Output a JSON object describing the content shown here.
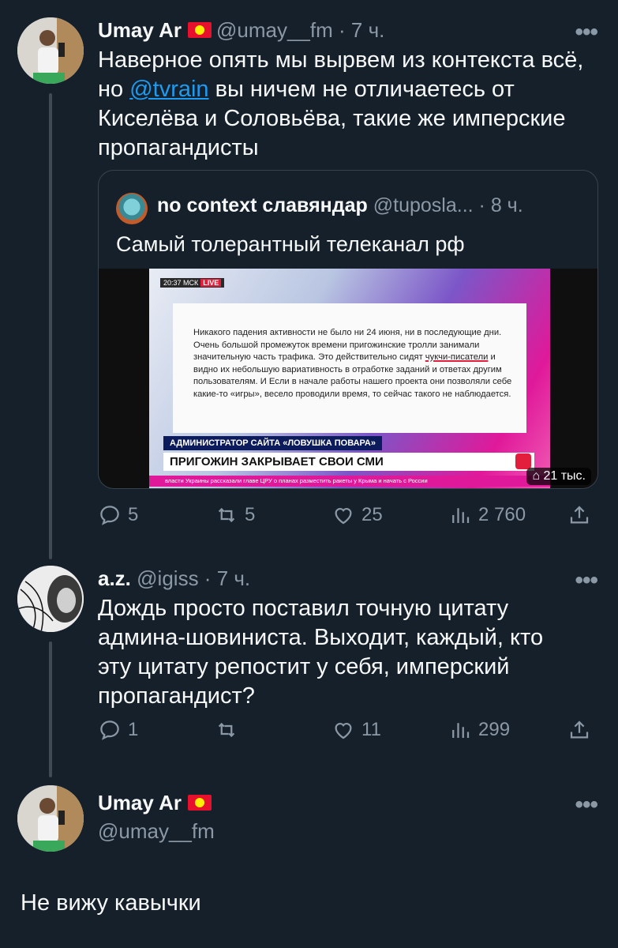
{
  "tweet1": {
    "name": "Umay Ar",
    "flag_icon": "kyrgyz-flag",
    "handle": "@umay__fm",
    "dot": "·",
    "time": "7 ч.",
    "more": "•••",
    "text_before": "Наверное опять мы вырвем из контекста всё, но ",
    "mention": "@tvrain",
    "text_after": " вы ничем не отличаетесь от Киселёва и Соловьёва, такие же имперские пропагандисты",
    "quote": {
      "name": "no context славяндар",
      "handle": "@tuposla...",
      "dot": "·",
      "time": "8 ч.",
      "text": "Самый толерантный телеканал рф",
      "media": {
        "live_time": "20:37 МСК",
        "live_badge": "LIVE",
        "card_text_1": "Никакого падения активности не было ни 24 июня, ни в последующие дни. Очень большой промежуток времени пригожинские тролли занимали значительную часть трафика. Это действительно сидят ",
        "card_underlined": "чукчи-писатели",
        "card_text_2": " и видно их небольшую вариативность в отработке заданий и ответах другим пользователям. И Если в начале работы нашего проекта они позволяли себе какие-то «игры», весело проводили время, то сейчас такого не наблюдается.",
        "strap_top": "АДМИНИСТРАТОР САЙТА «ЛОВУШКА ПОВАРА»",
        "strap_main": "ПРИГОЖИН ЗАКРЫВАЕТ СВОИ СМИ",
        "ticker": "власти Украины рассказали главе ЦРУ о планах разместить ракеты у Крыма и начать с России",
        "views": "21 тыс."
      }
    },
    "actions": {
      "replies": "5",
      "retweets": "5",
      "likes": "25",
      "views": "2 760"
    }
  },
  "tweet2": {
    "name": "a.z.",
    "handle": "@igiss",
    "dot": "·",
    "time": "7 ч.",
    "more": "•••",
    "text": "Дождь просто поставил точную цитату админа-шовиниста. Выходит, каждый, кто эту цитату репостит у себя, имперский пропагандист?",
    "actions": {
      "replies": "1",
      "retweets": "",
      "likes": "11",
      "views": "299"
    }
  },
  "tweet3": {
    "name": "Umay Ar",
    "handle": "@umay__fm",
    "more": "•••",
    "text": "Не вижу кавычки"
  }
}
